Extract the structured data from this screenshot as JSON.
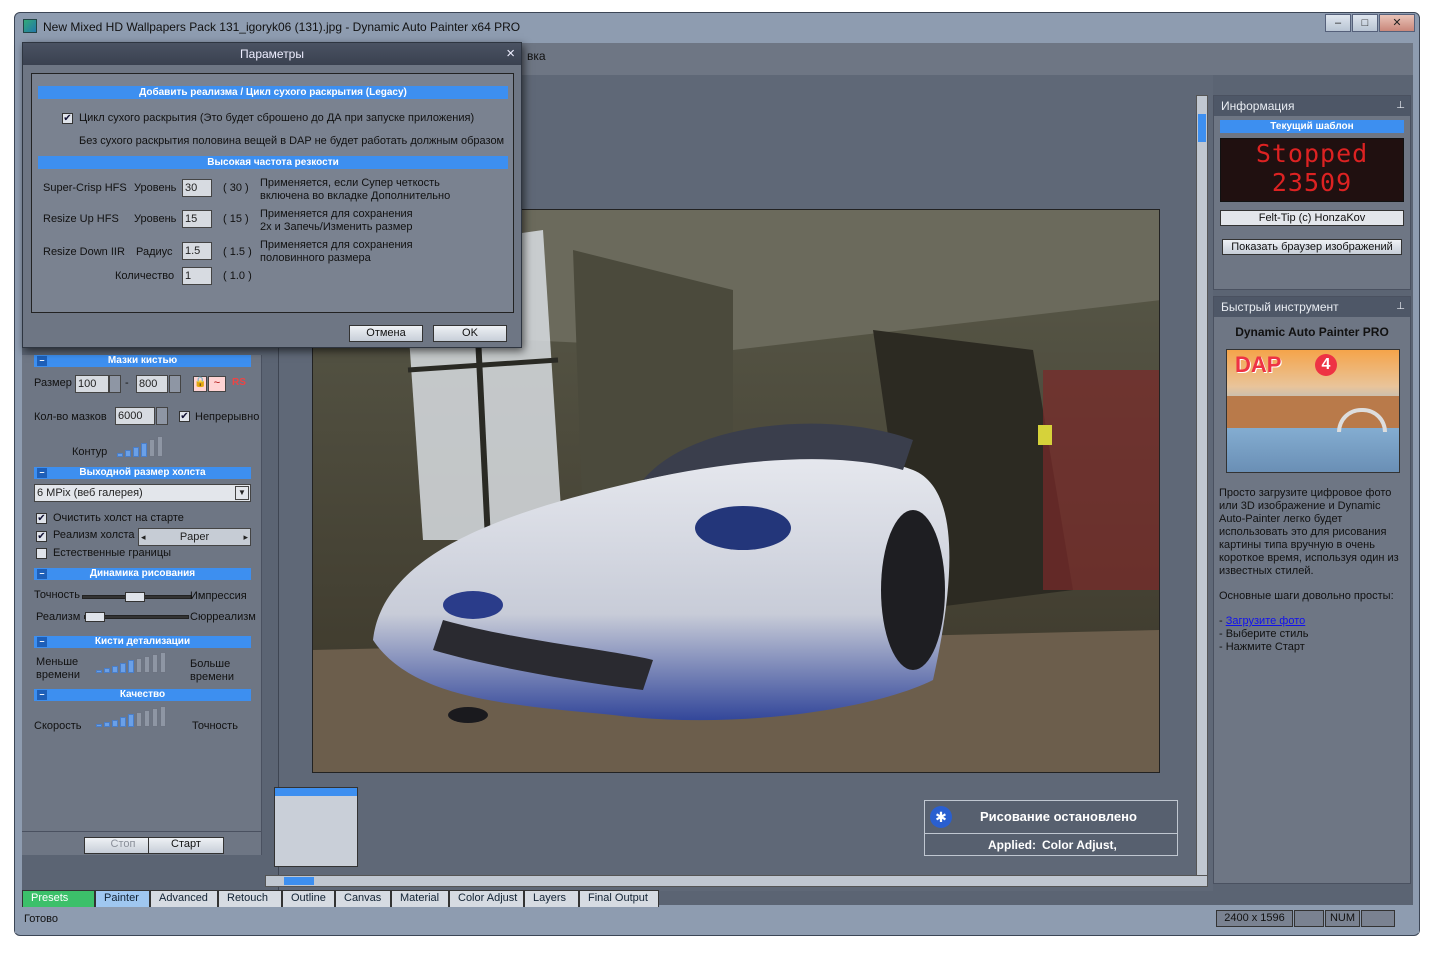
{
  "window": {
    "title": "New Mixed HD Wallpapers Pack 131_igoryk06 (131).jpg - Dynamic Auto Painter x64 PRO",
    "minimize": "–",
    "maximize": "□",
    "close": "✕",
    "menu_fragment": "вка"
  },
  "dialog": {
    "title": "Параметры",
    "close": "×",
    "section1": "Добавить реализма / Цикл сухого раскрытия  (Legacy)",
    "dry_cycle_label": "Цикл сухого раскрытия  (Это будет сброшено до ДА при запуске приложения)",
    "dry_cycle_checked": true,
    "dry_note": "Без сухого раскрытия половина вещей в DAP не будет работать должным образом",
    "section2": "Высокая частота резкости",
    "rows": [
      {
        "name": "Super-Crisp HFS",
        "param": "Уровень",
        "value": "30",
        "default": "( 30 )",
        "desc1": "Применяется, если Супер четкость",
        "desc2": "включена во вкладке Дополнительно"
      },
      {
        "name": "Resize Up HFS",
        "param": "Уровень",
        "value": "15",
        "default": "( 15 )",
        "desc1": "Применяется для сохранения",
        "desc2": "2х и Запечь/Изменить размер"
      },
      {
        "name": "Resize Down IIR",
        "param": "Радиус",
        "value": "1.5",
        "default": "( 1.5 )",
        "desc1": "Применяется для сохранения",
        "desc2": "половинного размера"
      },
      {
        "name": "",
        "param": "Количество",
        "value": "1",
        "default": "( 1.0 )",
        "desc1": "",
        "desc2": ""
      }
    ],
    "cancel": "Отмена",
    "ok": "OK"
  },
  "left": {
    "brush_masks": "Мазки кистью",
    "size_label": "Размер",
    "size_min": "100",
    "size_max": "800",
    "rs": "RS",
    "count_label": "Кол-во мазков",
    "count_value": "6000",
    "continuous_label": "Непрерывно",
    "continuous_checked": true,
    "contour_label": "Контур",
    "canvas_size": "Выходной размер холста",
    "canvas_select": "6 MPix (веб галерея)",
    "clear_label": "Очистить холст на старте",
    "clear_checked": true,
    "realism_label": "Реализм холста",
    "realism_checked": true,
    "paper": "Paper",
    "natural_label": "Естественные границы",
    "natural_checked": false,
    "dynamics": "Динамика рисования",
    "accuracy": "Точность",
    "impress": "Импрессия",
    "accuracy_level": 0.45,
    "realism": "Реализм",
    "surreal": "Сюрреализм",
    "realism_level": 0.08,
    "detail": "Кисти детализации",
    "less_time1": "Меньше",
    "less_time2": "времени",
    "more_time1": "Больше",
    "more_time2": "времени",
    "quality": "Качество",
    "speed": "Скорость",
    "precision": "Точность",
    "stop": "Стоп",
    "start": "Старт"
  },
  "info": {
    "title": "Информация",
    "pin": "ᵖ",
    "template_head": "Текущий шаблон",
    "led_line1": "Stopped",
    "led_line2": "23509",
    "template_name": "Felt-Tip (c) HonzaKov",
    "browser_btn": "Показать браузер изображений"
  },
  "quick": {
    "title": "Быстрый инструмент",
    "product": "Dynamic Auto Painter PRO",
    "logo": "DAP",
    "desc": "Просто загрузите цифровое фото или 3D изображение и Dynamic Auto-Painter легко будет использовать это для рисования картины типа вручную в очень короткое время, используя один из известных стилей.",
    "steps_head": "Основные шаги довольно просты:",
    "step1_prefix": "- ",
    "step1_link": "Загрузите фото",
    "step2": "- Выберите стиль",
    "step3": "- Нажмите Старт"
  },
  "notification": {
    "title": "Рисование остановлено",
    "applied_label": "Applied:",
    "applied_value": "Color Adjust,"
  },
  "tabs": [
    "Presets",
    "Painter",
    "Advanced",
    "Retouch",
    "Outline",
    "Canvas",
    "Material",
    "Color Adjust",
    "Layers",
    "Final Output"
  ],
  "status": {
    "text": "Готово",
    "resolution": "2400 x 1596",
    "num": "NUM"
  },
  "colors": {
    "accent": "#3d8ff0",
    "led": "#dd2222",
    "panel": "#6e7684"
  }
}
